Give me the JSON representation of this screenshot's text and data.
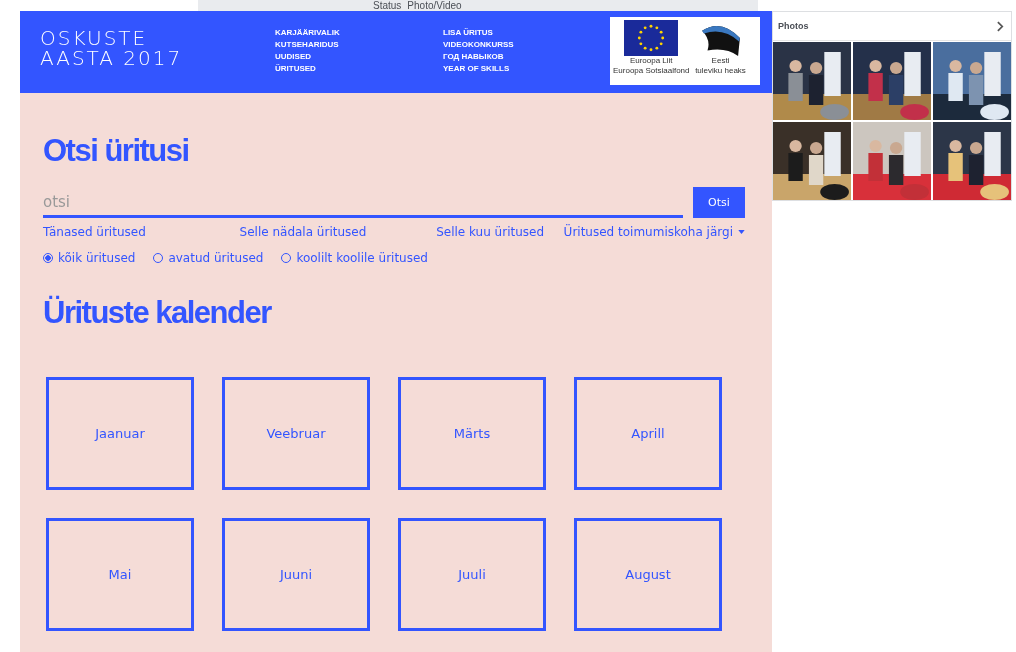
{
  "top_bar": {
    "items": [
      "Status",
      "Photo/Video"
    ]
  },
  "header": {
    "logo": [
      "OSKUSTE",
      "AASTA 2017"
    ],
    "nav_columns": [
      [
        "KARJÄÄRIVALIK",
        "KUTSEHARIDUS",
        "UUDISED",
        "ÜRITUSED"
      ],
      [
        "LISA ÜRITUS",
        "VIDEOKONKURSS",
        "ГОД НАВЫКОВ",
        "YEAR OF SKILLS"
      ]
    ],
    "partner_logo": {
      "eu_lines": [
        "Euroopa Liit",
        "Euroopa Sotsiaalfond"
      ],
      "ee_lines": [
        "Eesti",
        "tuleviku heaks"
      ]
    }
  },
  "search": {
    "title": "Otsi üritusi",
    "placeholder": "otsi",
    "button": "Otsi",
    "filters": [
      "Tänased üritused",
      "Selle nädala üritused",
      "Selle kuu üritused"
    ],
    "location_dropdown": "Üritused toimumiskoha järgi",
    "radios": [
      {
        "label": "kõik üritused",
        "selected": true
      },
      {
        "label": "avatud üritused",
        "selected": false
      },
      {
        "label": "koolilt koolile üritused",
        "selected": false
      }
    ]
  },
  "calendar": {
    "title": "Ürituste kalender",
    "months": [
      "Jaanuar",
      "Veebruar",
      "Märts",
      "Aprill",
      "Mai",
      "Juuni",
      "Juuli",
      "August"
    ]
  },
  "photos_panel": {
    "title": "Photos"
  }
}
